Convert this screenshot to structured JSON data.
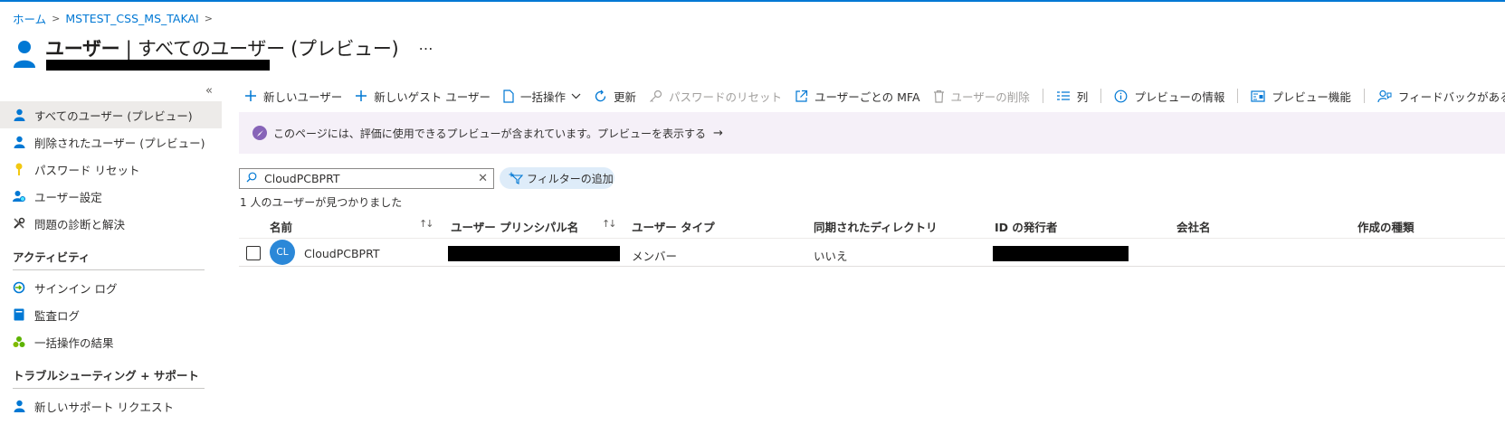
{
  "breadcrumb": {
    "home": "ホーム",
    "tenant": "MSTEST_CSS_MS_TAKAI"
  },
  "header": {
    "title_bold": "ユーザー",
    "title_rest": " | すべてのユーザー (プレビュー)",
    "more": "…"
  },
  "sidebar": {
    "collapse": "«",
    "items": [
      {
        "label": "すべてのユーザー (プレビュー)",
        "icon": "user-icon"
      },
      {
        "label": "削除されたユーザー (プレビュー)",
        "icon": "user-icon"
      },
      {
        "label": "パスワード リセット",
        "icon": "key-icon"
      },
      {
        "label": "ユーザー設定",
        "icon": "user-settings-icon"
      },
      {
        "label": "問題の診断と解決",
        "icon": "wrench-icon"
      }
    ],
    "sections": [
      {
        "title": "アクティビティ",
        "items": [
          {
            "label": "サインイン ログ",
            "icon": "signin-icon"
          },
          {
            "label": "監査ログ",
            "icon": "audit-log-icon"
          },
          {
            "label": "一括操作の結果",
            "icon": "bulk-results-icon"
          }
        ]
      },
      {
        "title": "トラブルシューティング + サポート",
        "items": [
          {
            "label": "新しいサポート リクエスト",
            "icon": "support-icon"
          }
        ]
      }
    ]
  },
  "toolbar": {
    "new_user": "新しいユーザー",
    "new_guest": "新しいゲスト ユーザー",
    "bulk": "一括操作",
    "refresh": "更新",
    "reset_password": "パスワードのリセット",
    "mfa": "ユーザーごとの MFA",
    "delete_user": "ユーザーの削除",
    "columns": "列",
    "preview_info": "プレビューの情報",
    "preview_features": "プレビュー機能",
    "feedback": "フィードバックがある場合"
  },
  "banner": {
    "text": "このページには、評価に使用できるプレビューが含まれています。プレビューを表示する",
    "arrow": "→"
  },
  "search": {
    "value": "CloudPCBPRT",
    "clear": "✕"
  },
  "filter": {
    "label": "フィルターの追加"
  },
  "result_count": "1 人のユーザーが見つかりました",
  "table": {
    "headers": [
      "名前",
      "ユーザー プリンシパル名",
      "ユーザー タイプ",
      "同期されたディレクトリ",
      "ID の発行者",
      "会社名",
      "作成の種類"
    ],
    "rows": [
      {
        "initials": "CL",
        "name": "CloudPCBPRT",
        "upn": "",
        "user_type": "メンバー",
        "synced": "いいえ",
        "issuer": "",
        "company": "",
        "creation_type": ""
      }
    ]
  },
  "colors": {
    "accent": "#0078d4",
    "banner_bg": "#f5f0f8",
    "avatar": "#2b88d8",
    "filter_bg": "#deecf9"
  }
}
